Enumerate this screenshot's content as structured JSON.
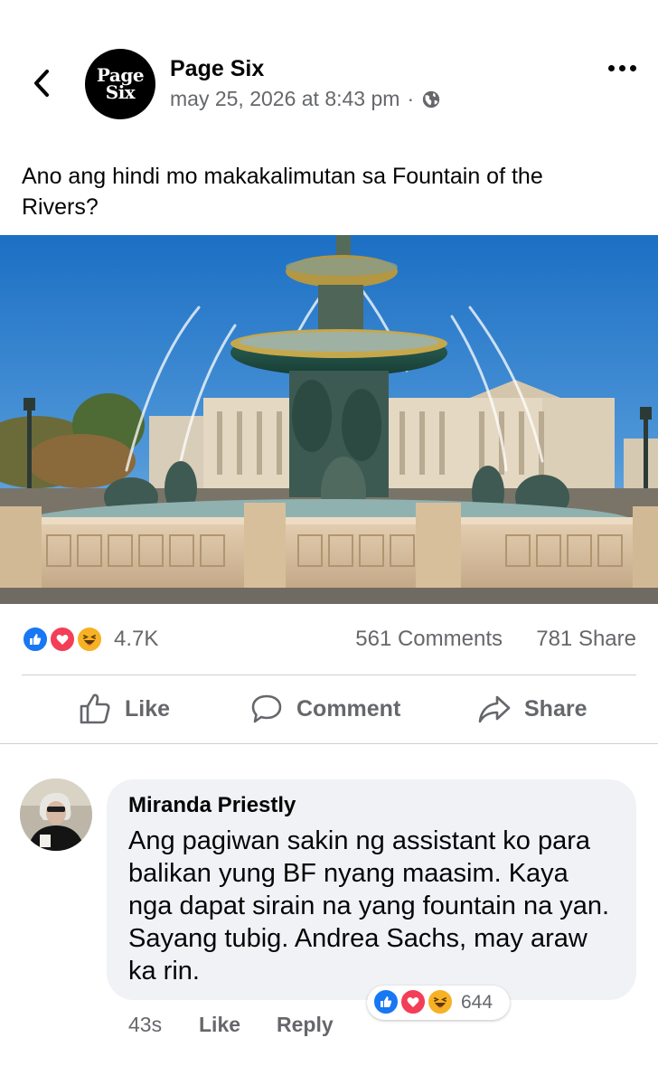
{
  "post": {
    "page_name": "Page Six",
    "logo_text_line1": "Page",
    "logo_text_line2": "Six",
    "timestamp": "may 25, 2026 at 8:43 pm",
    "separator": "·",
    "privacy_icon": "globe-icon",
    "text": "Ano ang hindi mo makakalimutan sa Fountain of the Rivers?",
    "image_alt": "Fountain of the Rivers at Place de la Concorde, Paris"
  },
  "stats": {
    "reaction_icons": [
      "like-icon",
      "love-icon",
      "haha-icon"
    ],
    "reaction_count": "4.7K",
    "comments": "561 Comments",
    "shares": "781 Share"
  },
  "actions": {
    "like_label": "Like",
    "comment_label": "Comment",
    "share_label": "Share"
  },
  "comment": {
    "author": "Miranda Priestly",
    "text": "Ang pagiwan sakin ng assistant ko para balikan yung BF nyang maasim. Kaya nga dapat sirain na yang fountain na yan. Sayang tubig. Andrea Sachs, may araw ka rin.",
    "reaction_count": "644",
    "time": "43s",
    "like_label": "Like",
    "reply_label": "Reply"
  },
  "colors": {
    "brand_blue": "#1877f2",
    "love_red": "#f33e58",
    "haha_yellow": "#f7b125",
    "muted_text": "#65676b",
    "bubble_bg": "#f0f2f5"
  }
}
